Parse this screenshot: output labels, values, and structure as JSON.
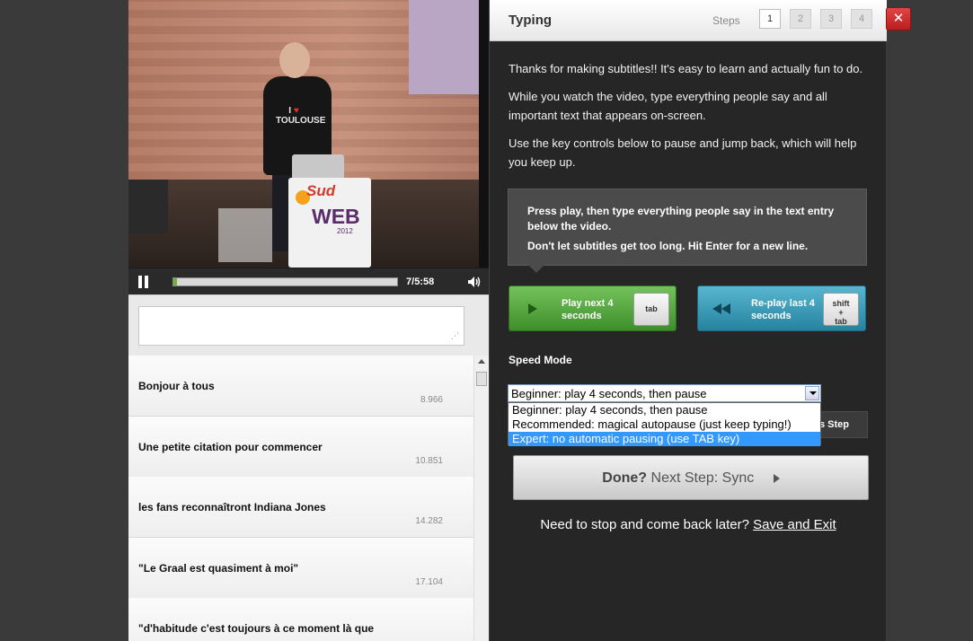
{
  "video": {
    "current_time": "7",
    "duration": "5:58",
    "progress": 0.016,
    "shirt_text": "TOULOUSE",
    "podium_brand": "Sud",
    "podium_brand2": "WEB",
    "podium_year": "2012"
  },
  "text_entry": {
    "value": "",
    "placeholder": ""
  },
  "subtitles": [
    {
      "text": "Bonjour à tous",
      "time": "8.966"
    },
    {
      "text": "Une petite citation pour commencer",
      "time": "10.851"
    },
    {
      "text": "les fans reconnaîtront Indiana Jones",
      "time": "14.282"
    },
    {
      "text": "\"Le Graal est quasiment à moi\"",
      "time": "17.104"
    },
    {
      "text": "\"d'habitude c'est toujours à ce moment là que",
      "time": ""
    }
  ],
  "panel": {
    "title": "Typing",
    "steps_label": "Steps",
    "steps": [
      "1",
      "2",
      "3",
      "4"
    ],
    "active_step": "1",
    "intro": [
      "Thanks for making subtitles!! It's easy to learn and actually fun to do.",
      "While you watch the video, type everything people say and all important text that appears on-screen.",
      "Use the key controls below to pause and jump back, which will help you keep up."
    ],
    "tip": {
      "line1": "Press play, then type everything people say in the text entry below the video.",
      "line2": "Don't let subtitles get too long. Hit Enter for a new line."
    },
    "play_next": {
      "label": "Play next 4 seconds",
      "key": "tab"
    },
    "replay": {
      "label": "Re-play last 4 seconds",
      "key_line1": "shift",
      "key_line2": "+",
      "key_line3": "tab"
    },
    "speed_mode_label": "Speed Mode",
    "speed_select": {
      "value": "Beginner: play 4 seconds, then pause",
      "options": [
        "Beginner: play 4 seconds, then pause",
        "Recommended: magical autopause (just keep typing!)",
        "Expert: no automatic pausing (use TAB key)"
      ],
      "highlighted_index": 2
    },
    "hidden_button_text": "s Step",
    "done": {
      "bold": "Done?",
      "rest": "Next Step: Sync"
    },
    "save_prompt": "Need to stop and come back later?",
    "save_link": "Save and Exit"
  },
  "close": "✕",
  "colors": {
    "green": "#4ea43a",
    "blue": "#339bb8",
    "highlight": "#3399ff",
    "close_red": "#d03030"
  }
}
